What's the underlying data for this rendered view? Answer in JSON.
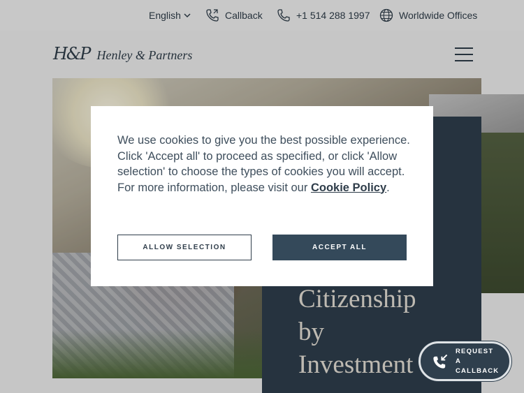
{
  "topbar": {
    "language": "English",
    "callback": "Callback",
    "phone": "+1 514 288 1997",
    "offices": "Worldwide Offices"
  },
  "header": {
    "logo_mark": "H&P",
    "logo_text": "Henley & Partners"
  },
  "hero": {
    "title_line1": "Citizenship",
    "title_line2": "by",
    "title_line3": "Investment"
  },
  "cookie": {
    "message": "We use cookies to give you the best possible experience. Click 'Accept all' to proceed as specified, or click 'Allow selection' to choose the types of cookies you will accept. For more information, please visit our",
    "policy_link": "Cookie Policy",
    "period": ".",
    "allow_label": "ALLOW SELECTION",
    "accept_label": "ACCEPT ALL"
  },
  "floating": {
    "callback_line1": "REQUEST A",
    "callback_line2": "CALLBACK"
  },
  "icons": {
    "chevron": "chevron-down-icon",
    "callback": "phone-callback-icon",
    "phone": "phone-icon",
    "globe": "globe-icon",
    "menu": "hamburger-icon"
  },
  "colors": {
    "brand_navy": "#2f3f4d",
    "text": "#3e4e5c",
    "button_solid": "#34495a",
    "title_cream": "#e8e3d9"
  }
}
